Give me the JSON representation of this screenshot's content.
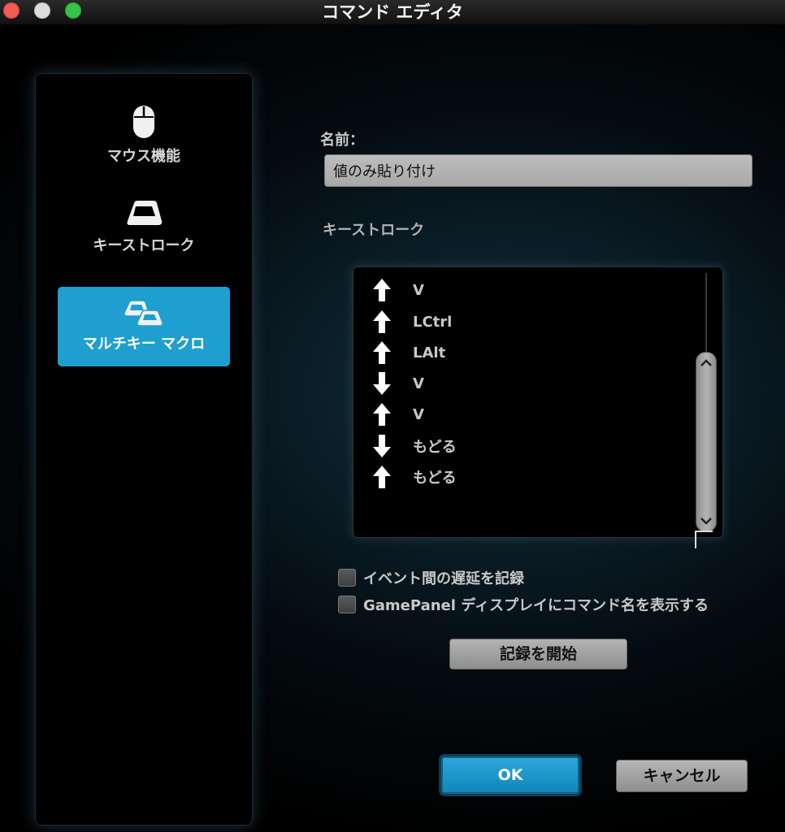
{
  "window": {
    "title": "コマンド エディタ"
  },
  "sidebar": {
    "items": [
      {
        "label": "マウス機能",
        "icon": "mouse-icon",
        "selected": false
      },
      {
        "label": "キーストローク",
        "icon": "key-icon",
        "selected": false
      },
      {
        "label": "マルチキー マクロ",
        "icon": "multi-key-icon",
        "selected": true
      }
    ]
  },
  "form": {
    "name_label": "名前：",
    "name_value": "値のみ貼り付け",
    "keystroke_label": "キーストローク"
  },
  "keystrokes": [
    {
      "direction": "up",
      "key": "V"
    },
    {
      "direction": "up",
      "key": "LCtrl"
    },
    {
      "direction": "up",
      "key": "LAlt"
    },
    {
      "direction": "down",
      "key": "V"
    },
    {
      "direction": "up",
      "key": "V"
    },
    {
      "direction": "down",
      "key": "もどる"
    },
    {
      "direction": "up",
      "key": "もどる"
    }
  ],
  "options": {
    "record_delay_label": "イベント間の遅延を記録",
    "record_delay_checked": false,
    "show_name_label": "GamePanel ディスプレイにコマンド名を表示する",
    "show_name_checked": false
  },
  "buttons": {
    "record_label": "記録を開始",
    "ok_label": "OK",
    "cancel_label": "キャンセル"
  },
  "colors": {
    "accent": "#1f9fd0",
    "background": "#000000"
  }
}
